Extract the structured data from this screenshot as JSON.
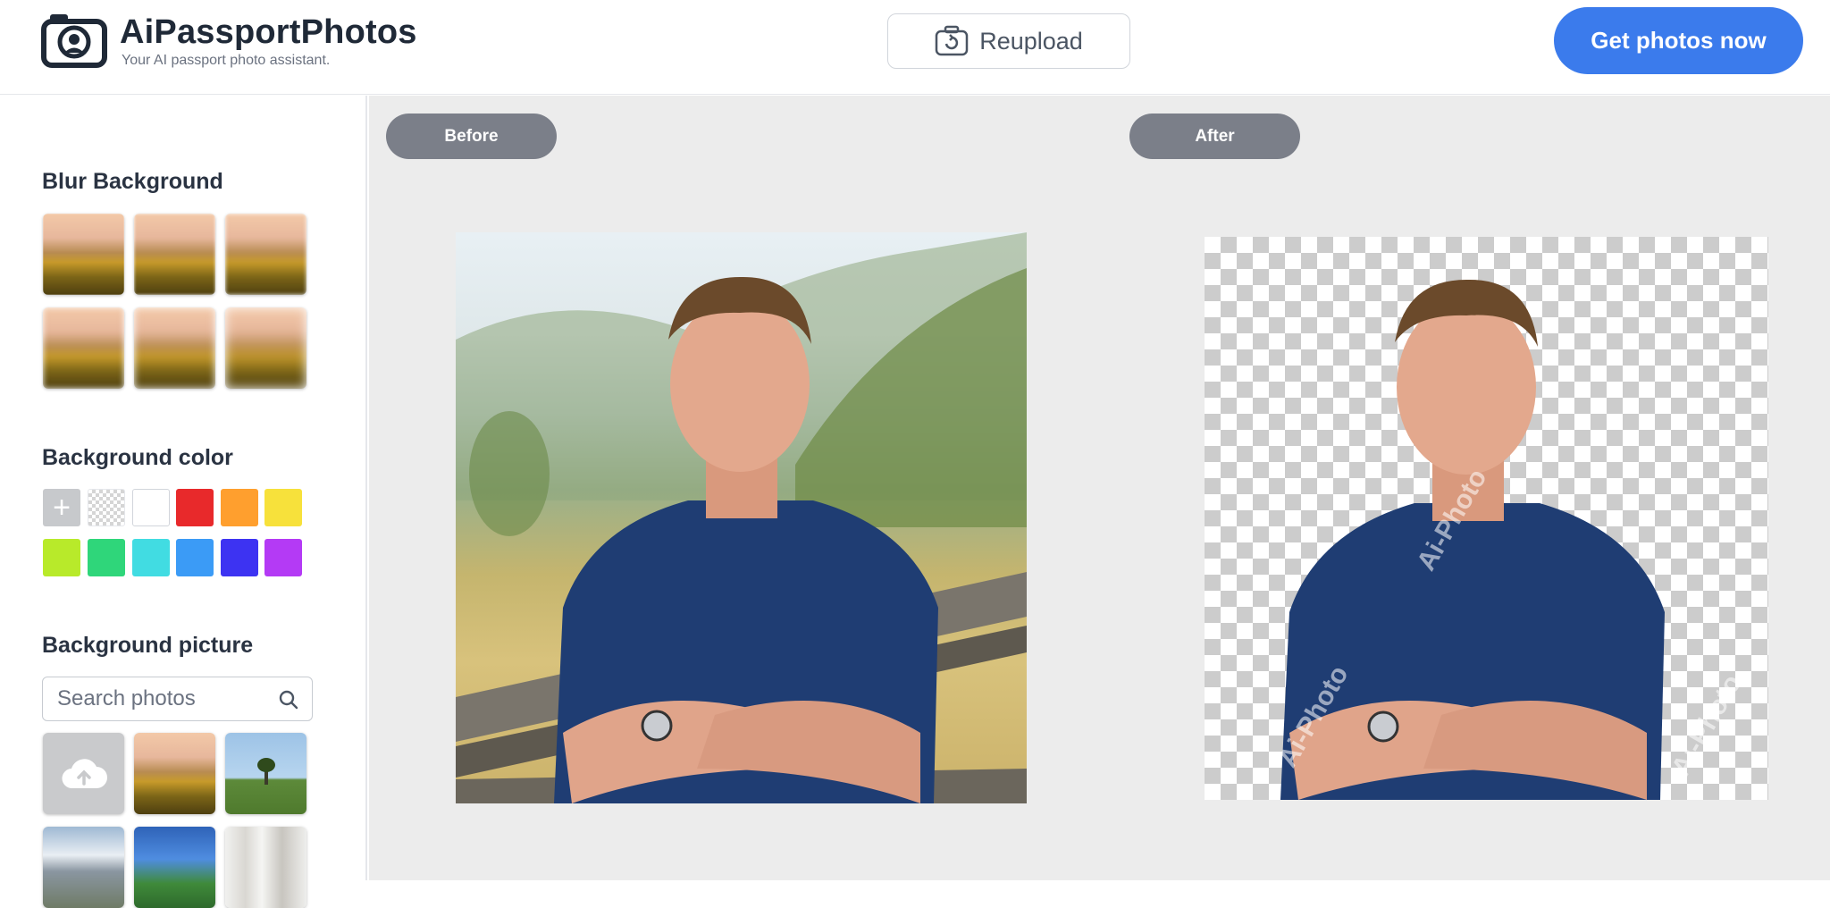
{
  "header": {
    "brand_name": "AiPassportPhotos",
    "tagline": "Your AI passport photo assistant.",
    "reupload_label": "Reupload",
    "cta_label": "Get photos now",
    "cta_color": "#3b7bec"
  },
  "sidebar": {
    "blur_title": "Blur Background",
    "blur_options": [
      "blur-level-1",
      "blur-level-2",
      "blur-level-3",
      "blur-level-4",
      "blur-level-5",
      "blur-level-6"
    ],
    "color_title": "Background color",
    "colors": [
      "add",
      "transparent",
      "#ffffff",
      "#e8292b",
      "#ff9f2e",
      "#f7e13b",
      "#b8ea2a",
      "#2fd67a",
      "#41dce2",
      "#3b9bf6",
      "#3d33f2",
      "#b43af5"
    ],
    "picture_title": "Background picture",
    "search_placeholder": "Search photos",
    "pictures": [
      "upload",
      "sunset-balloons",
      "tree-field",
      "mountain",
      "green-valley",
      "interior"
    ]
  },
  "main": {
    "before_label": "Before",
    "after_label": "After",
    "watermark": "Ai-Photo"
  }
}
